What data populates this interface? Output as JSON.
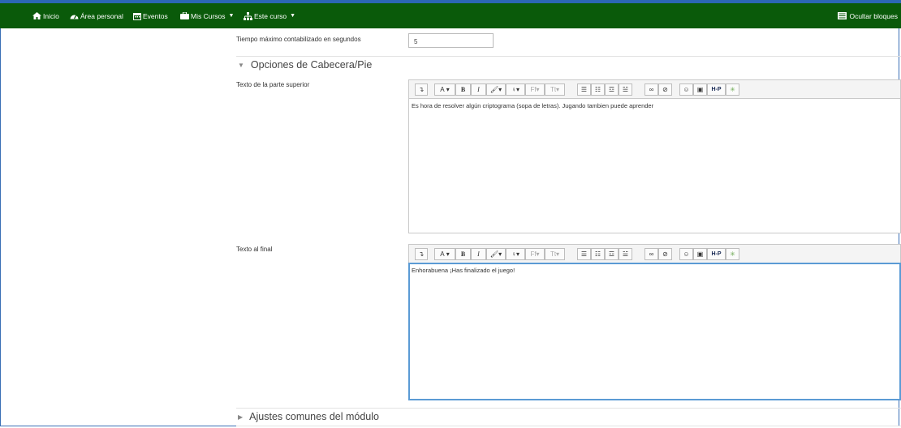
{
  "nav": {
    "home": "Inicio",
    "dashboard": "Área personal",
    "events": "Eventos",
    "my_courses": "Mis Cursos",
    "this_course": "Este curso",
    "hide_blocks": "Ocultar bloques"
  },
  "form": {
    "max_time_label": "Tiempo máximo contabilizado en segundos",
    "max_time_value": "5",
    "header_section": "Opciones de Cabecera/Pie",
    "top_text_label": "Texto de la parte superior",
    "top_text_value": "Es hora de resolver algún criptograma (sopa de letras). Jugando tambien puede aprender",
    "end_text_label": "Texto al final",
    "end_text_value": "Enhorabuena ¡Has finalizado el juego!",
    "common_section": "Ajustes comunes del módulo"
  },
  "toolbar": {
    "font_size": "A",
    "bold": "B",
    "italic": "I",
    "h5p": "H-P"
  },
  "colors": {
    "nav_bg": "#0a5a0a",
    "accent": "#2c67b5",
    "focus": "#5b9bd5"
  }
}
